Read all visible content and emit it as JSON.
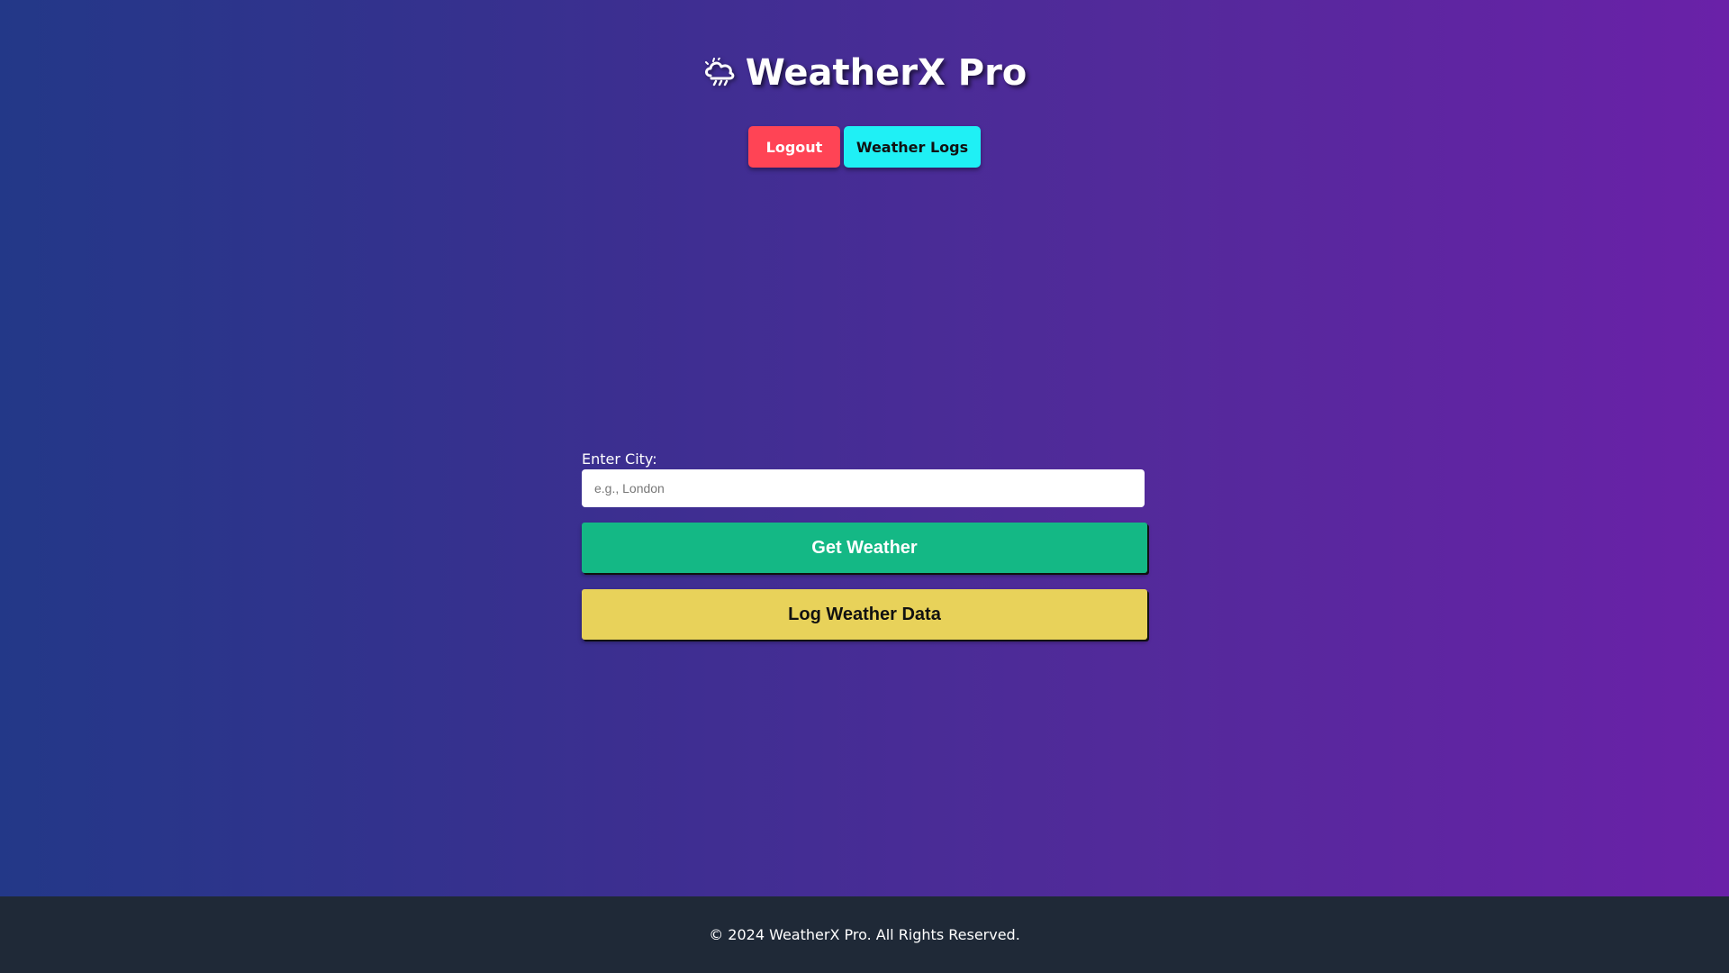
{
  "header": {
    "title": "WeatherX Pro",
    "icon": "cloud-rain-icon"
  },
  "nav": {
    "logout_label": "Logout",
    "logs_label": "Weather Logs"
  },
  "form": {
    "city_label": "Enter City:",
    "city_placeholder": "e.g., London",
    "city_value": "",
    "get_weather_label": "Get Weather",
    "log_weather_label": "Log Weather Data"
  },
  "footer": {
    "copyright": "© 2024 WeatherX Pro. All Rights Reserved."
  },
  "colors": {
    "gradient_start": "#233888",
    "gradient_end": "#6a21a8",
    "logout": "#ff4455",
    "logs": "#1ff0f5",
    "get_weather": "#14b885",
    "log_weather": "#e8d25a",
    "footer": "#1f2937"
  }
}
